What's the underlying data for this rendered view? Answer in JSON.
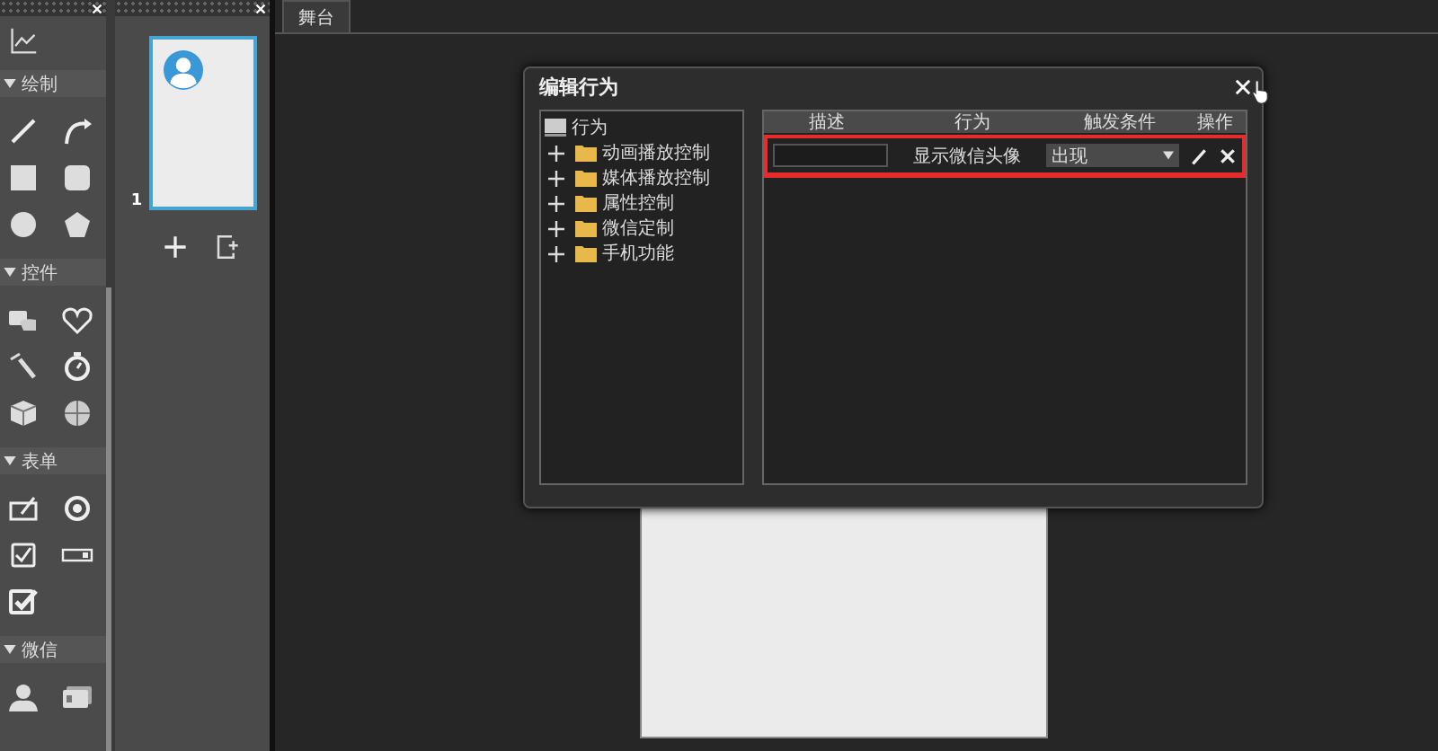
{
  "toolbox": {
    "sections": [
      {
        "title": "绘制",
        "expanded": true
      },
      {
        "title": "控件",
        "expanded": true
      },
      {
        "title": "表单",
        "expanded": true
      },
      {
        "title": "微信",
        "expanded": true
      }
    ]
  },
  "pages": [
    {
      "number": "1",
      "selected": true
    }
  ],
  "stage_tabs": [
    {
      "label": "舞台",
      "selected": true
    }
  ],
  "dialog": {
    "title": "编辑行为",
    "tree": {
      "label": "行为",
      "children": [
        {
          "label": "动画播放控制",
          "expanded": false
        },
        {
          "label": "媒体播放控制",
          "expanded": false
        },
        {
          "label": "属性控制",
          "expanded": false
        },
        {
          "label": "微信定制",
          "expanded": false
        },
        {
          "label": "手机功能",
          "expanded": false
        }
      ]
    },
    "table": {
      "columns": [
        "描述",
        "行为",
        "触发条件",
        "操作"
      ],
      "rows": [
        {
          "action": "显示微信头像",
          "trigger": "出现",
          "highlighted": true
        }
      ]
    }
  }
}
